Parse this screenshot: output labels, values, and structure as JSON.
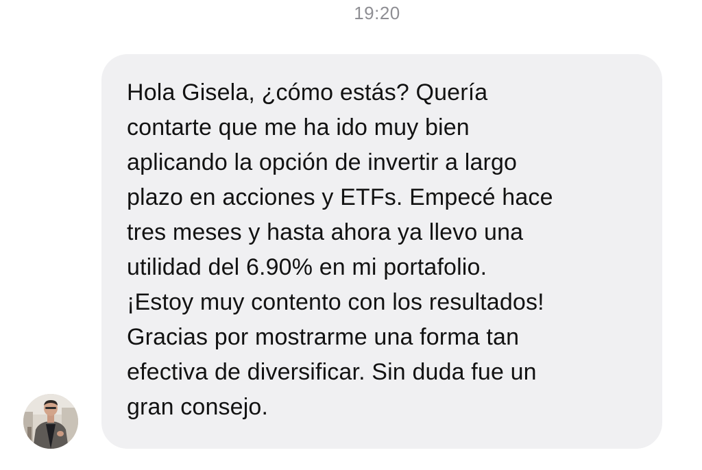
{
  "timestamp": "19:20",
  "message": {
    "sender_avatar": "contact-photo",
    "lines": [
      "Hola Gisela, ¿cómo estás? Quería",
      "contarte que me ha ido muy bien",
      "aplicando la opción de invertir a largo",
      "plazo en acciones y ETFs. Empecé hace",
      "tres meses y hasta ahora ya llevo una",
      "utilidad del 6.90% en mi portafolio.",
      "¡Estoy muy contento con los resultados!",
      "Gracias por mostrarme una forma tan",
      "efectiva de diversificar. Sin duda fue un",
      "gran consejo."
    ]
  },
  "colors": {
    "bubble_background": "#f0f0f2",
    "text": "#121212",
    "timestamp": "#8e8e93"
  }
}
